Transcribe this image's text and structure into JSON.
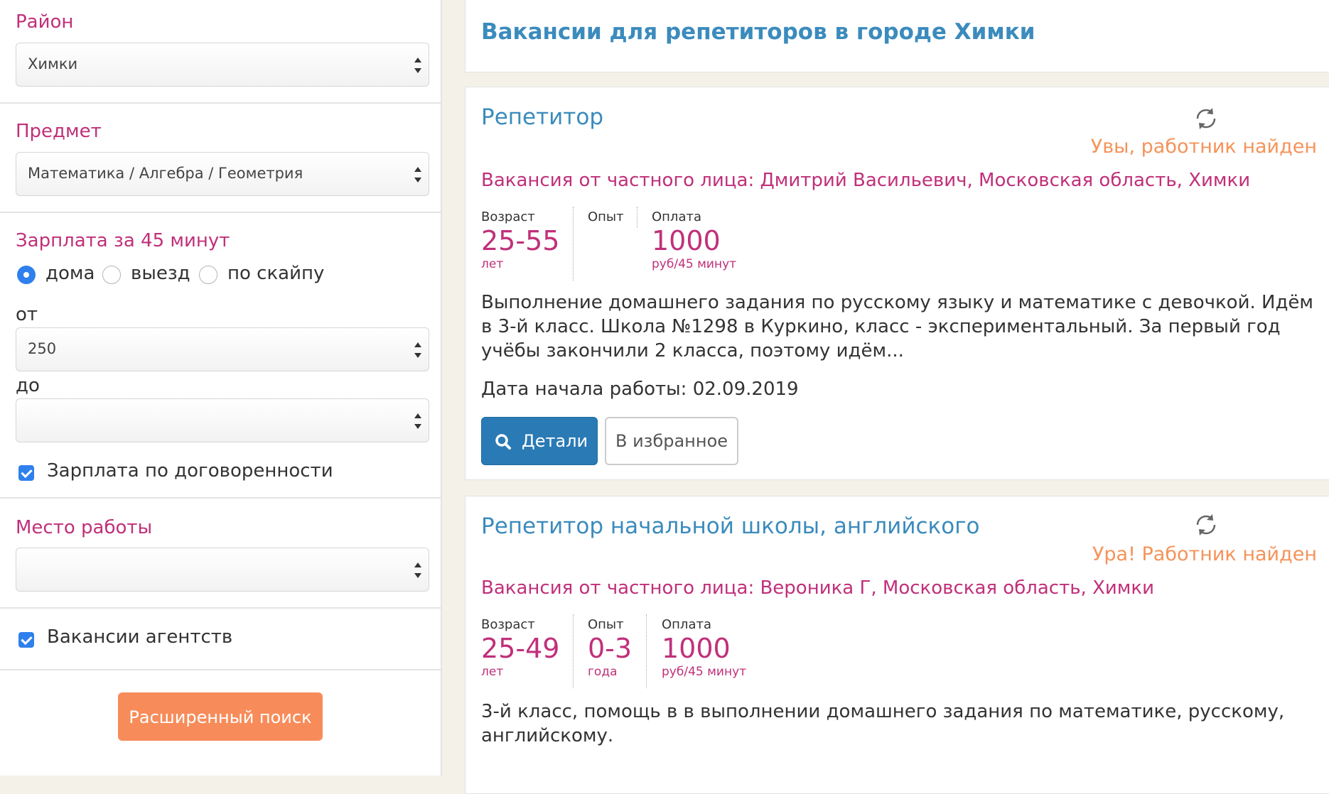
{
  "filters": {
    "district": {
      "label": "Район",
      "value": "Химки"
    },
    "subject": {
      "label": "Предмет",
      "value": "Математика / Алгебра / Геометрия"
    },
    "salary": {
      "label": "Зарплата за 45 минут",
      "options": [
        "дома",
        "выезд",
        "по скайпу"
      ],
      "selected": "дома",
      "from_label": "от",
      "from_value": "250",
      "to_label": "до",
      "to_value": "",
      "negotiable_label": "Зарплата по договоренности",
      "negotiable_checked": true
    },
    "workplace": {
      "label": "Место работы",
      "value": ""
    },
    "agencies": {
      "label": "Вакансии агентств",
      "checked": true
    },
    "advanced_search_label": "Расширенный поиск"
  },
  "page_title": "Вакансии для репетиторов в городе Химки",
  "vacancies": [
    {
      "title": "Репетитор",
      "status": "Увы, работник найден",
      "employer": "Вакансия от частного лица: Дмитрий Васильевич, Московская область, Химки",
      "age_caption": "Возраст",
      "age_value": "25-55",
      "age_unit": "лет",
      "experience_caption": "Опыт",
      "experience_value": "",
      "experience_unit": "",
      "pay_caption": "Оплата",
      "pay_value": "1000",
      "pay_unit": "руб/45 минут",
      "description": "Выполнение домашнего задания по русскому языку и математике с девочкой. Идём в 3-й класс. Школа №1298 в Куркино, класс - экспериментальный. За первый год учёбы закончили 2 класса, поэтому идём...",
      "start_date": "Дата начала работы: 02.09.2019",
      "details_label": "Детали",
      "favorite_label": "В избранное"
    },
    {
      "title": "Репетитор начальной школы, английского",
      "status": "Ура! Работник найден",
      "employer": "Вакансия от частного лица: Вероника Г, Московская область, Химки",
      "age_caption": "Возраст",
      "age_value": "25-49",
      "age_unit": "лет",
      "experience_caption": "Опыт",
      "experience_value": "0-3",
      "experience_unit": "года",
      "pay_caption": "Оплата",
      "pay_value": "1000",
      "pay_unit": "руб/45 минут",
      "description": "3-й класс, помощь в в выполнении домашнего задания по математике, русскому, английскому."
    }
  ],
  "colors": {
    "accent_magenta": "#c0307a",
    "title_blue": "#3b8bbd",
    "status_orange": "#f5935a",
    "button_blue": "#2a7ab5",
    "button_orange": "#f78c5a"
  }
}
